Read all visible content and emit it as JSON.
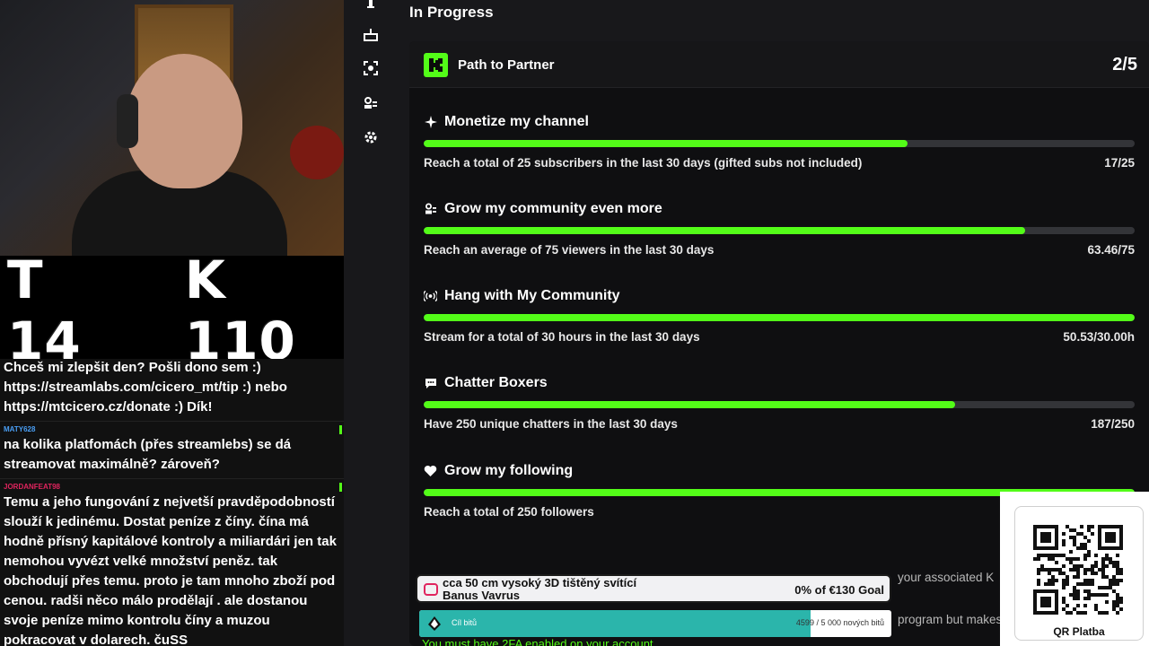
{
  "overlay": {
    "counter_t": "T 14",
    "counter_k": "K 110"
  },
  "chat": {
    "messages": [
      {
        "user": "",
        "user_color": "#ffffff",
        "text": "Chceš mi zlepšit den? Pošli dono sem :) https://streamlabs.com/cicero_mt/tip :) nebo https://mtcicero.cz/donate :) Dík!"
      },
      {
        "user": "MATY628",
        "user_color": "#4a9ff5",
        "text": "na kolika platfomách (přes streamlebs) se dá streamovat maximálně? zároveň?"
      },
      {
        "user": "JORDANFEAT98",
        "user_color": "#e0245e",
        "text": "Temu a jeho fungování z nejvetší pravděpodobností slouží k jedinému. Dostat peníze z číny. čína má hodně přísný kapitálové kontroly a miliardári jen tak nemohou vyvézt velké množství peněz. tak obchodují přes temu. proto je tam mnoho zboží pod cenou. radši něco málo prodělají . ale dostanou svoje peníze mimo kontrolu číny a muzou pokracovat v dolarech. čuSS"
      }
    ]
  },
  "main": {
    "heading": "In Progress",
    "card_title": "Path to Partner",
    "card_count": "2/5",
    "goals": [
      {
        "icon": "sparkle-icon",
        "title": "Monetize my channel",
        "desc": "Reach a total of 25 subscribers in the last 30 days (gifted subs not included)",
        "value": "17/25",
        "progress": 0.68
      },
      {
        "icon": "community-icon",
        "title": "Grow my community even more",
        "desc": "Reach an average of 75 viewers in the last 30 days",
        "value": "63.46/75",
        "progress": 0.846
      },
      {
        "icon": "broadcast-icon",
        "title": "Hang with My Community",
        "desc": "Stream for a total of 30 hours in the last 30 days",
        "value": "50.53/30.00h",
        "progress": 1.0
      },
      {
        "icon": "chat-bubble-icon",
        "title": "Chatter Boxers",
        "desc": "Have 250 unique chatters in the last 30 days",
        "value": "187/250",
        "progress": 0.748
      },
      {
        "icon": "heart-icon",
        "title": "Grow my following",
        "desc": "Reach a total of 250 followers",
        "value": "",
        "progress": 1.0
      }
    ],
    "footnote_1": "your associated K",
    "footnote_2": "program but makes",
    "footnote_3": "You must have 2FA enabled on your account"
  },
  "donation": {
    "title_line1": "cca 50 cm vysoký 3D tištěný svítící",
    "title_line2": "Banus Vavrus",
    "percent": "0% of €130 Goal"
  },
  "bits_goal": {
    "label": "Cíl bitů",
    "numbers": "4599 / 5 000 nových bitů",
    "progress": 0.92
  },
  "qr": {
    "label": "QR Platba"
  },
  "colors": {
    "accent": "#53fc18",
    "bits_fill": "#2bb5ab"
  }
}
